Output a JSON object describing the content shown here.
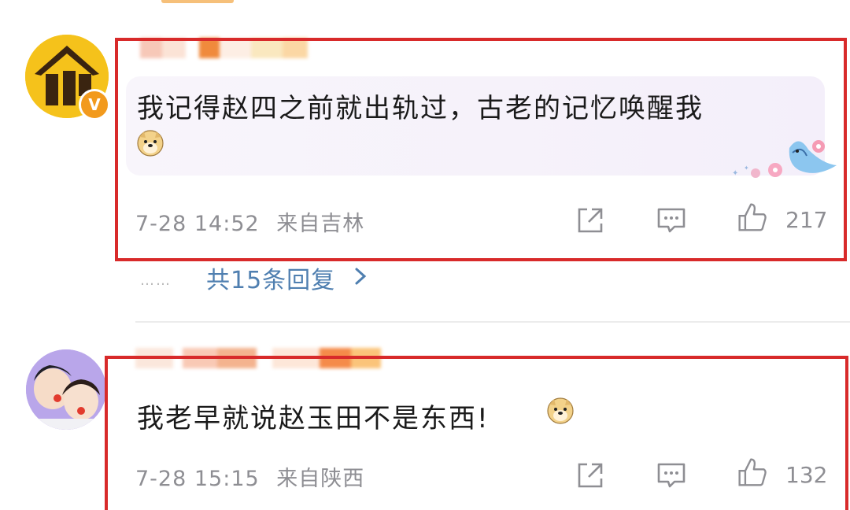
{
  "comments": [
    {
      "text": "我记得赵四之前就出轨过，古老的记忆唤醒我",
      "emoji": "doge-emoji",
      "time": "7-28 14:52",
      "location": "来自吉林",
      "likes": "217",
      "verified_badge": "V",
      "replies_label": "共15条回复",
      "replies_dots": "……"
    },
    {
      "text": "我老早就说赵玉田不是东西!",
      "emoji": "doge-emoji",
      "time": "7-28 15:15",
      "location": "来自陕西",
      "likes": "132"
    }
  ],
  "icons": {
    "share": "share-icon",
    "comment": "comment-icon",
    "like": "thumbs-up-icon",
    "chevron": "chevron-right-icon"
  },
  "colors": {
    "highlight": "#d82a2a",
    "link": "#4f7fb0",
    "meta": "#8e8e93",
    "badge": "#f29a1d"
  }
}
